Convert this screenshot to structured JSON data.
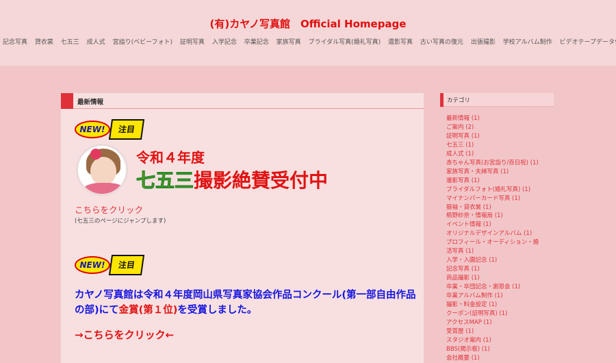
{
  "header": {
    "title": "(有)カヤノ写真館　Official Homepage",
    "nav": [
      "記念写真",
      "貸衣裳",
      "七五三",
      "成人式",
      "宮詣り(ベビーフォト)",
      "証明写真",
      "入学記念",
      "卒業記念",
      "家族写真",
      "ブライダル写真(婚礼写真)",
      "遺影写真",
      "古い写真の復元",
      "出張撮影",
      "学校アルバム制作",
      "ビデオテープデータ化"
    ]
  },
  "main": {
    "section_title": "最新情報",
    "badge_new": "NEW!",
    "badge_chumoku": "注目",
    "banner_line1": "令和４年度",
    "banner_shichi": "七五三",
    "banner_rest": "撮影絶賛受付中",
    "link1": "こちらをクリック",
    "note1": "(七五三のページにジャンプします)",
    "award_part1": "カヤノ写真館は令和４年度岡山県写真家協会作品コンクール(第一部自由作品の部)にて",
    "award_red": "金賞(第１位)",
    "award_part2": "を受賞しました。",
    "link2": "→こちらをクリック←"
  },
  "sidebar": {
    "title": "カテゴリ",
    "categories": [
      "最新情報 (1)",
      "ご案内 (2)",
      "証明写真 (1)",
      "七五三 (1)",
      "成人式 (1)",
      "赤ちゃん写真(お宮詣り/百日祝) (1)",
      "家族写真・夫婦写真 (1)",
      "遺影写真 (1)",
      "ブライダルフォト(婚礼写真) (1)",
      "マイナンバーカード写真 (1)",
      "振袖・貸衣裳 (1)",
      "栢野紗奈・情報局 (1)",
      "イベント情報 (1)",
      "オリジナルデザインアルバム (1)",
      "プロフィール・オーディション・婚",
      "活写真 (1)",
      "入学・入園記念 (1)",
      "記念写真 (1)",
      "商品撮影 (1)",
      "卒業・卒団記念・謝恩会 (1)",
      "卒業アルバム制作 (1)",
      "撮影・料金設定 (1)",
      "クーポン(証明写真) (1)",
      "アクセスMAP (1)",
      "受賞歴 (1)",
      "スタジオ案内 (1)",
      "BBS(掲示板) (1)",
      "会社概要 (1)"
    ]
  },
  "colors": {
    "accent": "#e0313b",
    "award_blue": "#1515e0",
    "background": "#f2c6c8"
  }
}
